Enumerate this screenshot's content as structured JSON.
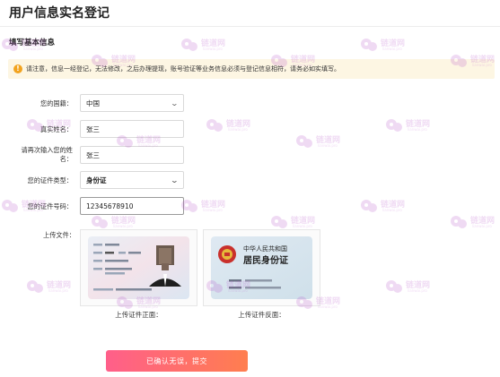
{
  "page": {
    "title": "用户信息实名登记"
  },
  "section": {
    "title": "填写基本信息"
  },
  "notice": {
    "icon": "warning-icon",
    "text": "请注意，信息一经登记，无法修改，之后办理提现，账号验证等业务信息必须与登记信息相符，请务必如实填写。"
  },
  "form": {
    "nationality": {
      "label": "您的国籍：",
      "value": "中国"
    },
    "real_name": {
      "label": "真实姓名：",
      "value": "张三"
    },
    "confirm_name": {
      "label": "请再次输入您的姓名：",
      "value": "张三"
    },
    "id_type": {
      "label": "您的证件类型：",
      "value": "身份证"
    },
    "id_number": {
      "label": "您的证件号码：",
      "value": "12345678910"
    },
    "upload": {
      "label": "上传文件：",
      "front_caption": "上传证件正面：",
      "back_caption": "上传证件反面：",
      "back_card_title": "中华人民共和国",
      "back_card_subtitle": "居民身份证"
    }
  },
  "submit": {
    "label": "已确认无误，提交"
  },
  "watermark": {
    "text": "链道网",
    "sub": "lianwai.pro"
  },
  "colors": {
    "accent_start": "#ff5f8a",
    "accent_end": "#ff7e4f",
    "notice_bg": "#fdf6e3",
    "warning": "#f2a31f"
  }
}
